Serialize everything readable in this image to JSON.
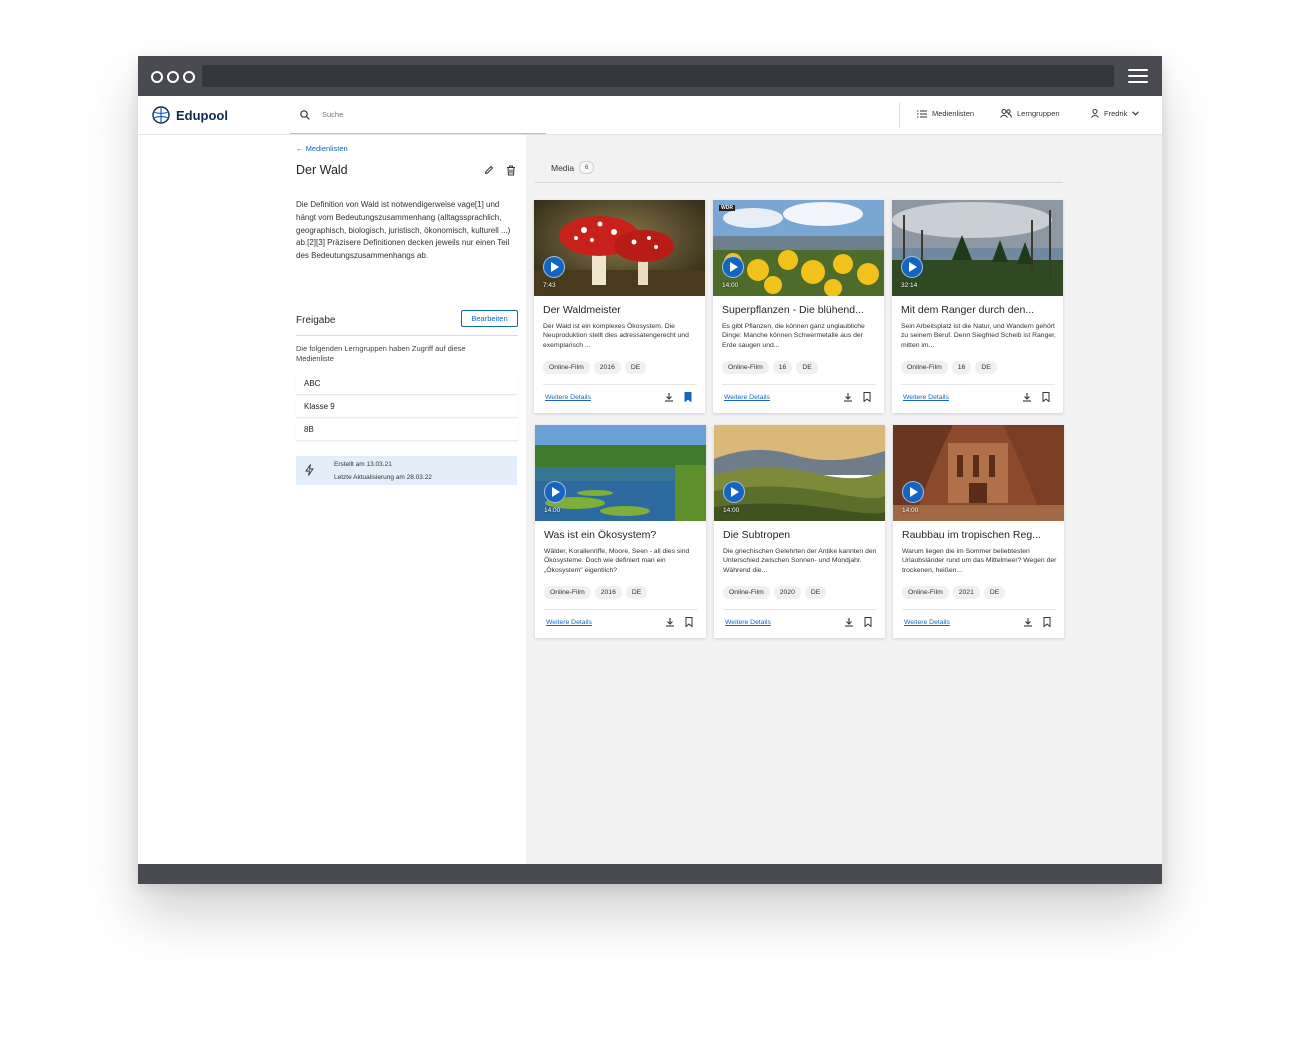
{
  "brand": {
    "name": "Edupool"
  },
  "search": {
    "placeholder": "Suche"
  },
  "nav": {
    "medienlisten": "Medienlisten",
    "lerngruppen": "Lerngruppen",
    "user": "Fredrik"
  },
  "sidebar": {
    "back_link": "← Medienlisten",
    "title": "Der Wald",
    "description": "Die Definition von Wald ist notwendigerweise vage[1] und hängt vom Bedeutungszusammenhang (alltagssprachlich, geographisch, biologisch, juristisch, ökonomisch, kulturell ...) ab.[2][3] Präzisere Definitionen decken jeweils nur einen Teil des Bedeutungszusammenhangs ab.",
    "share_title": "Freigabe",
    "edit_button": "Bearbeiten",
    "share_note": "Die folgenden Lerngruppen haben Zugriff auf diese Medienliste",
    "groups": [
      "ABC",
      "Klasse 9",
      "8B"
    ],
    "created": "Erstellt am 13.03.21",
    "updated": "Letzte Aktualisierung am 28.03.22"
  },
  "media_tab": {
    "label": "Media",
    "count": "6"
  },
  "cards": [
    {
      "duration": "7:43",
      "title": "Der Waldmeister",
      "description": "Der Wald ist ein komplexes Ökosystem. Die Neuproduktion stellt dies adressatengerecht und exemplarisch ...",
      "tags": [
        "Online-Film",
        "2016",
        "DE"
      ],
      "details": "Weitere Details",
      "bookmarked": true,
      "icon": "mushroom-image"
    },
    {
      "duration": "14:00",
      "badge": "WDR",
      "title": "Superpflanzen - Die blühend...",
      "description": "Es gibt Pflanzen, die können ganz unglaubliche Dinge: Manche können Schwermetalle aus der Erde saugen und...",
      "tags": [
        "Online-Film",
        "16",
        "DE"
      ],
      "details": "Weitere Details",
      "bookmarked": false,
      "icon": "flowers-image"
    },
    {
      "duration": "32:14",
      "title": "Mit dem Ranger durch den...",
      "description": "Sein Arbeitsplatz ist die Natur, und Wandern gehört zu seinem Beruf. Denn Siegfried Scheib ist Ranger, mitten im...",
      "tags": [
        "Online-Film",
        "16",
        "DE"
      ],
      "details": "Weitere Details",
      "bookmarked": false,
      "icon": "forest-image"
    },
    {
      "duration": "14:00",
      "title": "Was ist ein Ökosystem?",
      "description": "Wälder, Korallenriffe, Moore, Seen - all dies sind Ökosysteme. Doch wie definiert man ein „Ökosystem\" eigentlich?",
      "tags": [
        "Online-Film",
        "2016",
        "DE"
      ],
      "details": "Weitere Details",
      "bookmarked": false,
      "icon": "lake-image"
    },
    {
      "duration": "14:00",
      "title": "Die Subtropen",
      "description": "Die griechischen Gelehrten der Antike kannten den Unterschied zwischen Sonnen- und Mondjahr. Während die...",
      "tags": [
        "Online-Film",
        "2020",
        "DE"
      ],
      "details": "Weitere Details",
      "bookmarked": false,
      "icon": "hills-image"
    },
    {
      "duration": "14:00",
      "title": "Raubbau im tropischen Reg...",
      "description": "Warum liegen die im Sommer beliebtesten Urlaubsländer rund um das Mittelmeer? Wegen der trockenen, heißen...",
      "tags": [
        "Online-Film",
        "2021",
        "DE"
      ],
      "details": "Weitere Details",
      "bookmarked": false,
      "icon": "petra-image"
    }
  ],
  "colors": {
    "accent": "#1565c0",
    "chrome": "#4a4a52",
    "meta_box": "#e4eef9"
  }
}
